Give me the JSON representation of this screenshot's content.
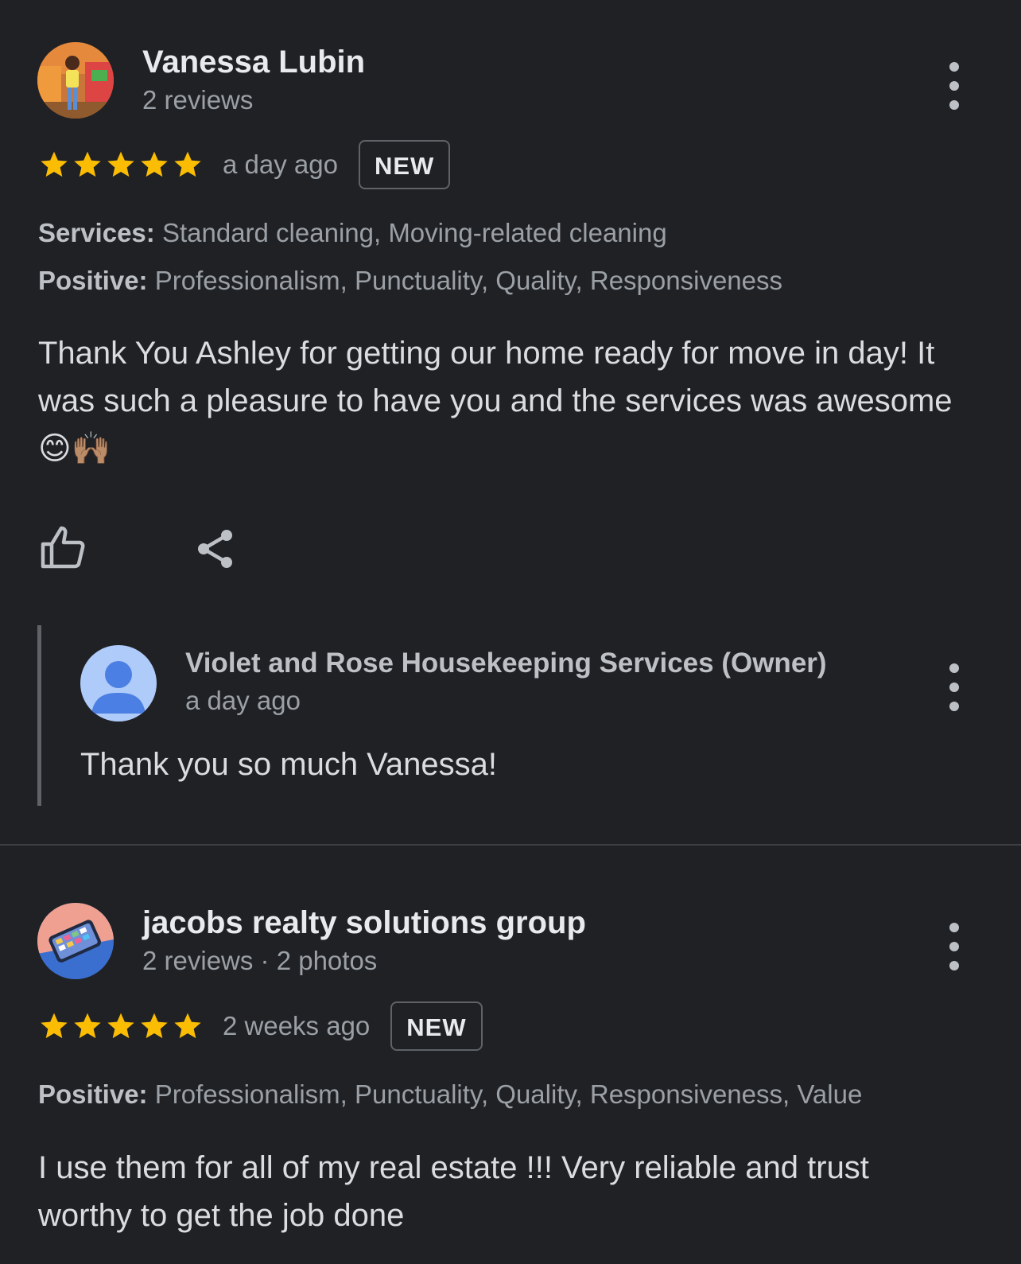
{
  "reviews": [
    {
      "reviewer_name": "Vanessa Lubin",
      "reviewer_meta": "2 reviews",
      "rating": 5,
      "time_ago": "a day ago",
      "badge": "NEW",
      "services_label": "Services:",
      "services_value": "Standard cleaning, Moving-related cleaning",
      "positive_label": "Positive:",
      "positive_value": "Professionalism, Punctuality, Quality, Responsiveness",
      "text": "Thank You Ashley for getting our home ready for move in day! It was such a pleasure to have you and the services was awesome 😊🙌🏽",
      "reply": {
        "owner_name": "Violet and Rose Housekeeping Services (Owner)",
        "time_ago": "a day ago",
        "text": "Thank you so much Vanessa!"
      }
    },
    {
      "reviewer_name": "jacobs realty solutions group",
      "reviewer_meta": "2 reviews · 2 photos",
      "rating": 5,
      "time_ago": "2 weeks ago",
      "badge": "NEW",
      "positive_label": "Positive:",
      "positive_value": "Professionalism, Punctuality, Quality, Responsiveness, Value",
      "text": "I use them for all of my real estate !!! Very reliable and trust worthy to get the job done"
    }
  ],
  "colors": {
    "background": "#202124",
    "star": "#fbbc04",
    "text_primary": "#e8eaed",
    "text_secondary": "#9aa0a6"
  },
  "icons": [
    "thumbs-up-icon",
    "share-icon",
    "more-vert-icon",
    "star-icon",
    "person-icon"
  ]
}
